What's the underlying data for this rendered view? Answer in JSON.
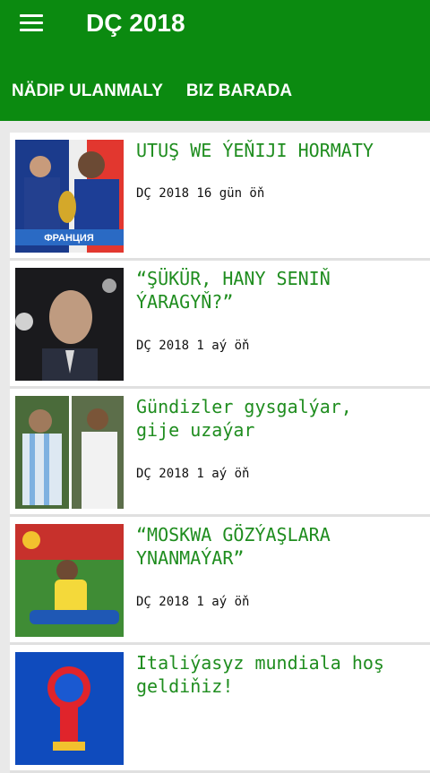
{
  "app": {
    "title": "DÇ 2018"
  },
  "colors": {
    "accent": "#0b8a10",
    "headline": "#1f8d1f"
  },
  "tabs": [
    {
      "label": "NÄDIP ULANMALY"
    },
    {
      "label": "BIZ BARADA"
    }
  ],
  "articles": [
    {
      "title": "UTUŞ WE ÝEŇIJI HORMATY",
      "meta": "DÇ 2018 16 gün öň",
      "thumb_caption": "ФРАНЦИЯ"
    },
    {
      "title": "“ŞÜKÜR, HANY SENIŇ\nÝARAGYŇ?”",
      "meta": "DÇ 2018 1 aý öň"
    },
    {
      "title": "Gündizler gysgalýar,\ngije uzaýar",
      "meta": "DÇ 2018 1 aý öň"
    },
    {
      "title": "“MOSKWA GÖZÝAŞLARA\nYNANMAÝAR”",
      "meta": "DÇ 2018 1 aý öň"
    },
    {
      "title": "Italiýasyz mundiala hoş\ngeldiňiz!",
      "meta": ""
    }
  ]
}
